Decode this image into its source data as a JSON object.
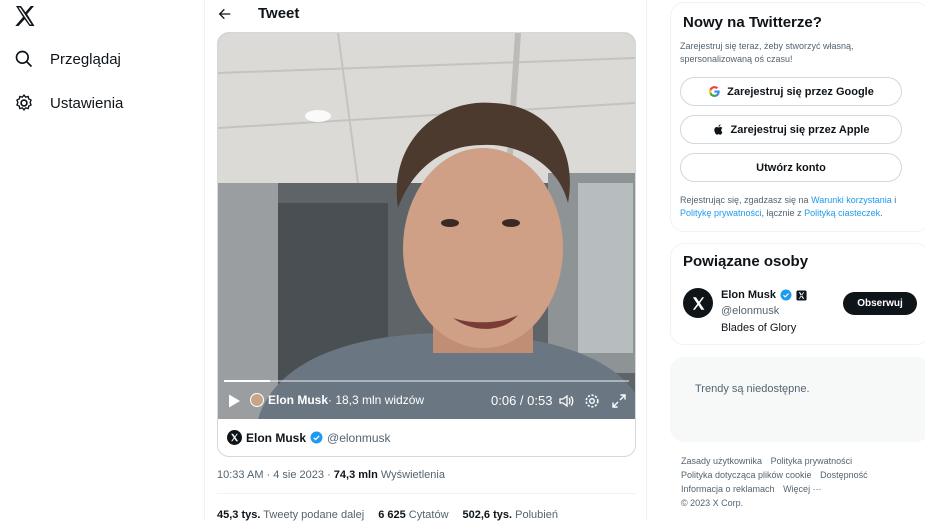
{
  "nav": {
    "items": [
      {
        "label": "Przeglądaj",
        "icon": "search-icon"
      },
      {
        "label": "Ustawienia",
        "icon": "gear-icon"
      }
    ]
  },
  "header": {
    "title": "Tweet"
  },
  "video": {
    "author": "Elon Musk",
    "views": "· 18,3 mln widzów",
    "time": "0:06 / 0:53",
    "progress": 0.113
  },
  "media_author": {
    "name": "Elon Musk",
    "handle": "@elonmusk"
  },
  "tweet_meta": {
    "time_date": "10:33 AM · 4 sie 2023 · ",
    "views_count": "74,3 mln",
    "views_label": " Wyświetlenia"
  },
  "stats": {
    "retweets_count": "45,3 tys.",
    "retweets_label": " Tweety podane dalej",
    "quotes_count": "6 625",
    "quotes_label": " Cytatów",
    "likes_count": "502,6 tys.",
    "likes_label": " Polubień"
  },
  "signup": {
    "title": "Nowy na Twitterze?",
    "subtitle": "Zarejestruj się teraz, żeby stworzyć własną, spersonalizowaną oś czasu!",
    "google": "Zarejestruj się przez Google",
    "apple": "Zarejestruj się przez Apple",
    "create": "Utwórz konto",
    "legal_1": "Rejestrując się, zgadzasz się na ",
    "legal_terms": "Warunki korzystania",
    "legal_2": " i ",
    "legal_privacy": "Politykę prywatności",
    "legal_3": ", łącznie z ",
    "legal_cookies": "Polityką ciasteczek",
    "legal_4": "."
  },
  "related": {
    "title": "Powiązane osoby",
    "name": "Elon Musk",
    "handle": "@elonmusk",
    "bio": "Blades of Glory",
    "follow": "Obserwuj"
  },
  "trends": {
    "text": "Trendy są niedostępne."
  },
  "footer": {
    "links": [
      "Zasady użytkownika",
      "Polityka prywatności",
      "Polityka dotycząca plików cookie",
      "Dostępność",
      "Informacja o reklamach",
      "Więcej ···"
    ],
    "copyright": "© 2023 X Corp."
  },
  "colors": {
    "accent": "#1d9bf0",
    "text": "#0f1419",
    "muted": "#536471"
  }
}
